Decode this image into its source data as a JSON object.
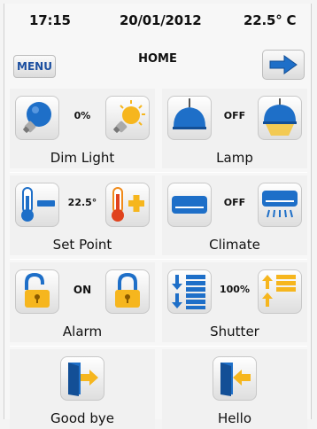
{
  "status": {
    "time": "17:15",
    "date": "20/01/2012",
    "temperature": "22.5° C"
  },
  "header": {
    "menu_label": "MENU",
    "title": "HOME"
  },
  "tiles": [
    {
      "label": "Dim Light",
      "value": "0%"
    },
    {
      "label": "Lamp",
      "value": "OFF"
    },
    {
      "label": "Set Point",
      "value": "22.5°"
    },
    {
      "label": "Climate",
      "value": "OFF"
    },
    {
      "label": "Alarm",
      "value": "ON"
    },
    {
      "label": "Shutter",
      "value": "100%"
    },
    {
      "label": "Good bye"
    },
    {
      "label": "Hello"
    }
  ],
  "colors": {
    "accent_blue": "#1e6fc8",
    "sun_yellow": "#f6b61e",
    "heat_orange": "#f08a1a"
  }
}
